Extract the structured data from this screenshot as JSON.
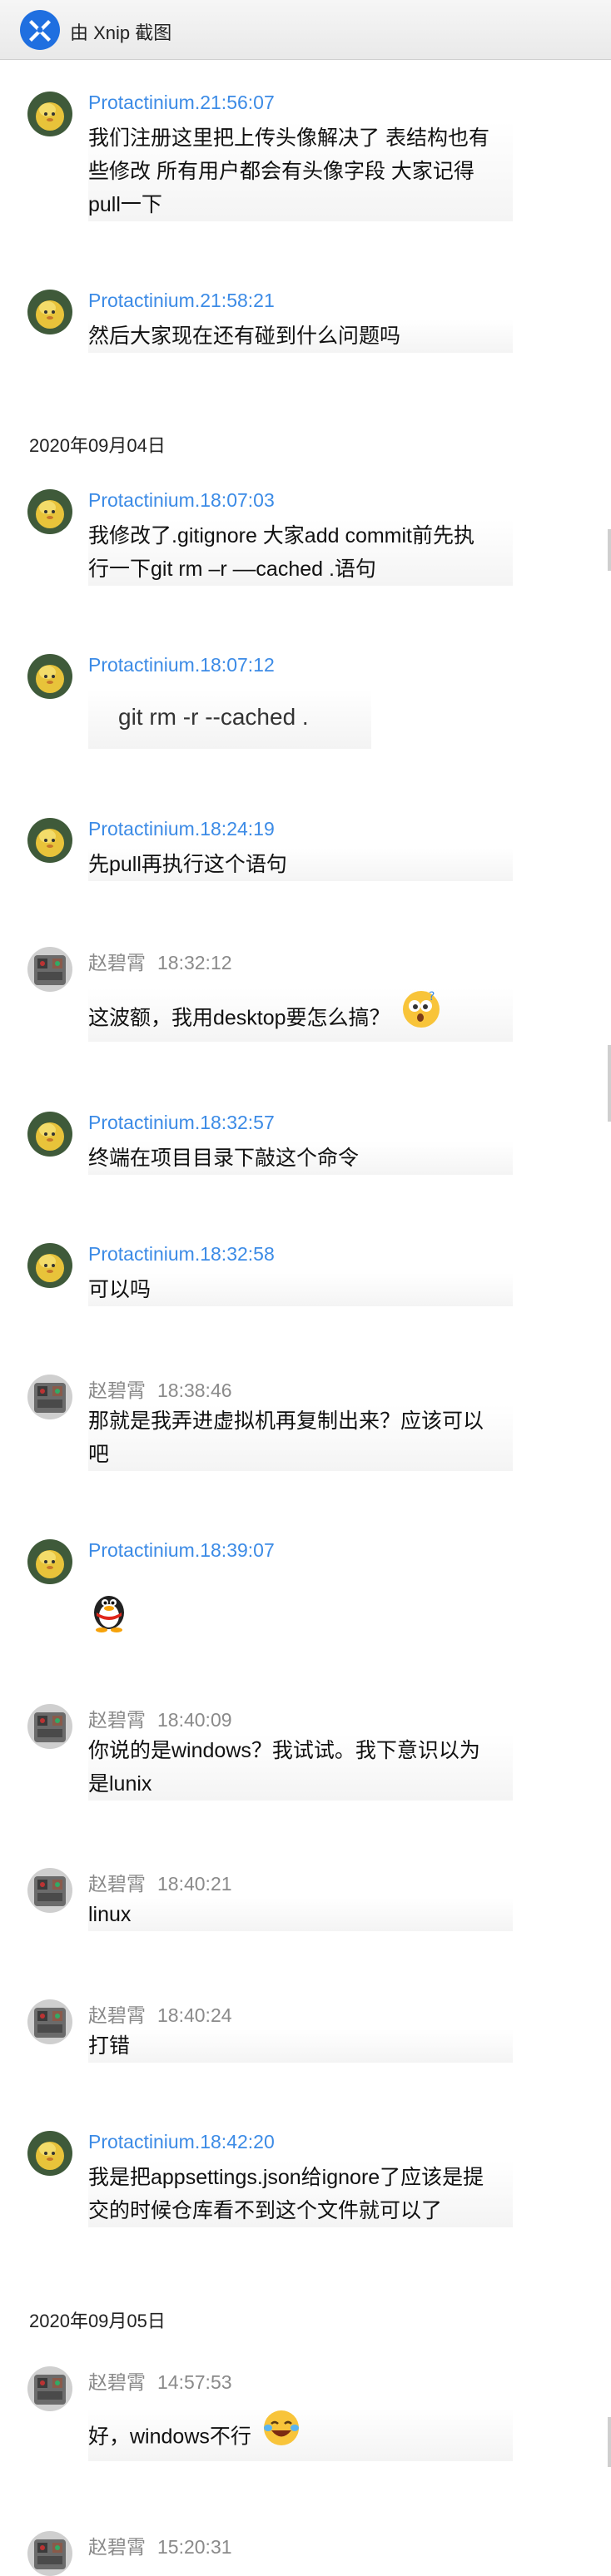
{
  "window": {
    "title": "由 Xnip 截图"
  },
  "date_separators": [
    "2020年09月04日",
    "2020年09月05日"
  ],
  "messages": [
    {
      "sender": "Protactinium.",
      "time": "21:56:07",
      "lines": [
        "我们注册这里把上传头像解决了 表结构也有",
        "些修改 所有用户都会有头像字段 大家记得",
        "pull一下"
      ]
    },
    {
      "sender": "Protactinium.",
      "time": "21:58:21",
      "lines": [
        "然后大家现在还有碰到什么问题吗"
      ]
    },
    {
      "sender": "Protactinium.",
      "time": "18:07:03",
      "lines": [
        "我修改了.gitignore 大家add commit前先执",
        "行一下git rm –r ––cached .语句"
      ]
    },
    {
      "sender": "Protactinium.",
      "time": "18:07:12",
      "code": "git rm -r --cached ."
    },
    {
      "sender": "Protactinium.",
      "time": "18:24:19",
      "lines": [
        "先pull再执行这个语句"
      ]
    },
    {
      "sender": "赵碧霄",
      "time": "18:32:12",
      "lines": [
        "这波额，我用desktop要怎么搞？"
      ],
      "emoji": "confused-face-emoji"
    },
    {
      "sender": "Protactinium.",
      "time": "18:32:57",
      "lines": [
        "终端在项目目录下敲这个命令"
      ]
    },
    {
      "sender": "Protactinium.",
      "time": "18:32:58",
      "lines": [
        "可以吗"
      ]
    },
    {
      "sender": "赵碧霄",
      "time": "18:38:46",
      "lines": [
        "那就是我弄进虚拟机再复制出来？应该可以",
        "吧"
      ]
    },
    {
      "sender": "Protactinium.",
      "time": "18:39:07",
      "sticker": "qq-penguin-sticker"
    },
    {
      "sender": "赵碧霄",
      "time": "18:40:09",
      "lines": [
        "你说的是windows？我试试。我下意识以为",
        "是lunix"
      ]
    },
    {
      "sender": "赵碧霄",
      "time": "18:40:21",
      "lines": [
        "linux"
      ]
    },
    {
      "sender": "赵碧霄",
      "time": "18:40:24",
      "lines": [
        "打错"
      ]
    },
    {
      "sender": "Protactinium.",
      "time": "18:42:20",
      "lines": [
        "我是把appsettings.json给ignore了应该是提",
        "交的时候仓库看不到这个文件就可以了"
      ]
    },
    {
      "sender": "赵碧霄",
      "time": "14:57:53",
      "lines": [
        "好，windows不行"
      ],
      "emoji": "laughing-tears-emoji"
    },
    {
      "sender": "赵碧霄",
      "time": "15:20:31"
    }
  ]
}
